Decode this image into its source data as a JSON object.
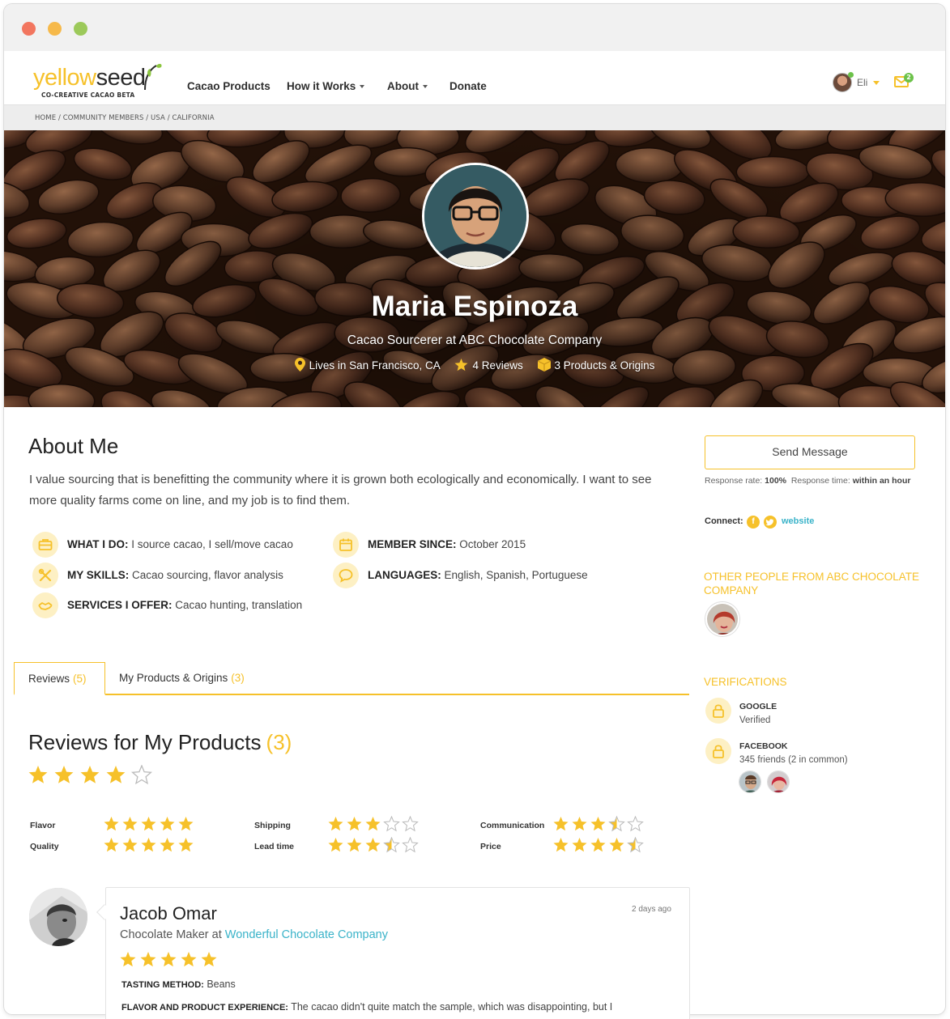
{
  "nav": {
    "logo_yellow": "yellow",
    "logo_dark": "seed",
    "logo_tagline": "CO-CREATIVE CACAO BETA",
    "links": [
      "Cacao Products",
      "How it Works",
      "About",
      "Donate"
    ],
    "user_name": "Eli",
    "mail_count": "2"
  },
  "breadcrumb": "HOME / COMMUNITY MEMBERS / USA / CALIFORNIA",
  "profile": {
    "name": "Maria Espinoza",
    "title": "Cacao Sourcerer at ABC Chocolate Company",
    "location": "Lives in San Francisco, CA",
    "reviews": "4 Reviews",
    "products": "3 Products & Origins"
  },
  "about": {
    "heading": "About Me",
    "text": "I value sourcing that is benefitting the community where it is grown both ecologically and economically. I want to see more quality farms come on line, and my job is to find them.",
    "facts": [
      {
        "label": "WHAT I DO:",
        "value": " I source cacao, I sell/move cacao",
        "icon": "briefcase-icon"
      },
      {
        "label": "MEMBER SINCE:",
        "value": " October 2015",
        "icon": "calendar-icon"
      },
      {
        "label": "MY SKILLS:",
        "value": " Cacao sourcing, flavor analysis",
        "icon": "tools-icon"
      },
      {
        "label": "LANGUAGES:",
        "value": " English, Spanish, Portuguese",
        "icon": "speech-bubble-icon"
      },
      {
        "label": "SERVICES I OFFER:",
        "value": " Cacao hunting, translation",
        "icon": "handshake-icon"
      }
    ]
  },
  "sidebar": {
    "send_message": "Send Message",
    "response_rate_label": "Response rate: ",
    "response_rate": "100%",
    "response_time_label": "Response time: ",
    "response_time": "within an hour",
    "connect_label": "Connect:",
    "website": "website",
    "other_people_heading": "OTHER PEOPLE FROM ABC CHOCOLATE COMPANY",
    "verifications_heading": "VERIFICATIONS",
    "verifications": [
      {
        "title": "GOOGLE",
        "sub": "Verified"
      },
      {
        "title": "FACEBOOK",
        "sub": "345 friends (2 in common)"
      }
    ]
  },
  "tabs": [
    {
      "label": "Reviews",
      "count": "(5)"
    },
    {
      "label": "My Products & Origins",
      "count": "(3)"
    }
  ],
  "reviews_section": {
    "heading": "Reviews for My Products",
    "count": "(3)",
    "overall_rating": 4,
    "ratings": [
      {
        "label": "Flavor",
        "value": 5
      },
      {
        "label": "Shipping",
        "value": 3
      },
      {
        "label": "Communication",
        "value": 3.5
      },
      {
        "label": "Quality",
        "value": 5
      },
      {
        "label": "Lead time",
        "value": 3.5
      },
      {
        "label": "Price",
        "value": 4.5
      }
    ]
  },
  "review": {
    "name": "Jacob Omar",
    "time": "2 days ago",
    "role_prefix": "Chocolate Maker at ",
    "company": "Wonderful Chocolate Company",
    "rating": 5,
    "method_label": "TASTING METHOD:",
    "method_value": " Beans",
    "experience_label": "FLAVOR AND PRODUCT EXPERIENCE:",
    "experience_value": " The cacao didn't quite match the sample, which was disappointing, but I"
  },
  "colors": {
    "accent": "#f6c12a",
    "link": "#3ab3c9"
  }
}
